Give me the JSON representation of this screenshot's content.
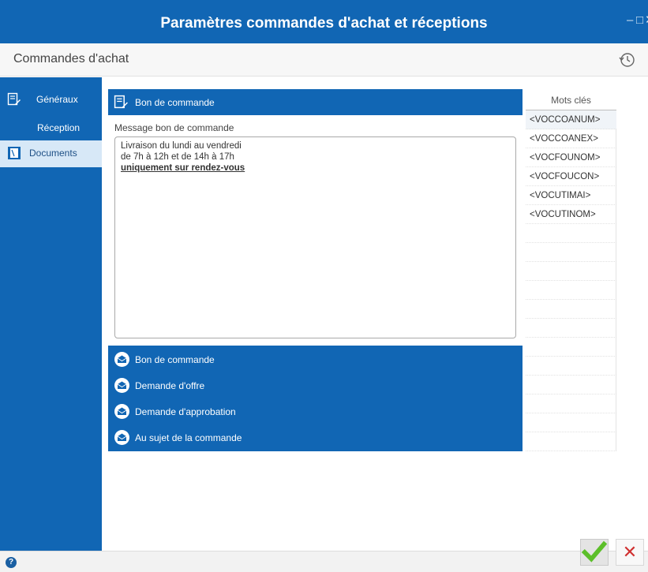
{
  "window": {
    "title": "Paramètres commandes d'achat et réceptions",
    "minimize_glyph": "–",
    "maximize_glyph": "□",
    "close_glyph": "✕"
  },
  "subheader": {
    "title": "Commandes d'achat",
    "history_icon": "history-icon"
  },
  "sidebar": {
    "items": [
      {
        "label": "Généraux",
        "icon": "edit-document-icon",
        "active": false
      },
      {
        "label": "Réception",
        "icon": "",
        "active": false
      },
      {
        "label": "Documents",
        "icon": "document-icon",
        "active": true
      }
    ]
  },
  "panel": {
    "header_label": "Bon de commande",
    "message_label": "Message bon de commande",
    "message_lines": [
      "Livraison du lundi au vendredi",
      "de 7h à 12h et de 14h à 17h",
      "uniquement sur rendez-vous"
    ]
  },
  "templates": [
    {
      "label": "Bon de commande",
      "icon": "envelope-icon"
    },
    {
      "label": "Demande d'offre",
      "icon": "envelope-icon"
    },
    {
      "label": "Demande d'approbation",
      "icon": "envelope-icon"
    },
    {
      "label": "Au sujet de la commande",
      "icon": "envelope-icon"
    }
  ],
  "keywords": {
    "header": "Mots clés",
    "items": [
      "<VOCCOANUM>",
      "<VOCCOANEX>",
      "<VOCFOUNOM>",
      "<VOCFOUCON>",
      "<VOCUTIMAI>",
      "<VOCUTINOM>"
    ]
  },
  "footer": {
    "help_glyph": "?",
    "cancel_glyph": "✕"
  },
  "colors": {
    "accent": "#1166b4",
    "ok": "#5cbf2a",
    "cancel": "#d03030"
  }
}
